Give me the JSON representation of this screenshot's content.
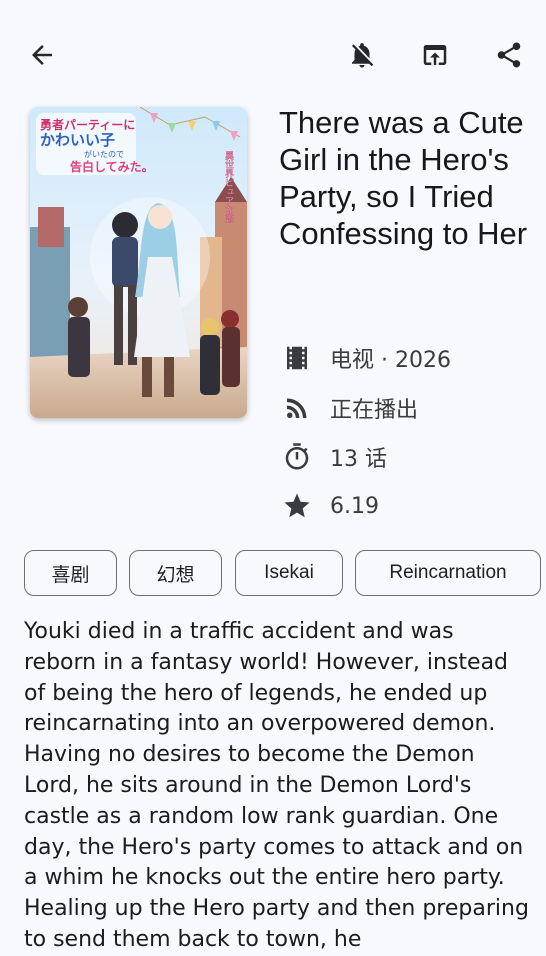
{
  "header": {
    "back_icon": "arrow-back-icon",
    "notifications_icon": "notifications-off-icon",
    "open_icon": "open-in-browser-icon",
    "share_icon": "share-icon"
  },
  "anime": {
    "title": "There was a Cute Girl in the Hero's Party, so I Tried Confessing to Her",
    "poster_title_lines": [
      "勇者パーティーに",
      "かわいい子",
      "がいたので",
      "告白してみた。"
    ],
    "poster_side_text": "異世界ピュアな恋",
    "type_year": "电视 · 2026",
    "status": "正在播出",
    "episodes": "13 话",
    "score": "6.19"
  },
  "tags": [
    "喜剧",
    "幻想",
    "Isekai",
    "Reincarnation"
  ],
  "description": "Youki died in a traffic accident and was reborn in a fantasy world! However, instead of being the hero of legends, he ended up reincarnating into an overpowered demon. Having no desires to become the Demon Lord, he sits around in the Demon Lord's castle as a random low rank guardian. One day, the Hero's party comes to attack and on a whim he knocks out the entire hero party. Healing up the Hero party and then preparing to send them back to town, he",
  "colors": {
    "background": "#f8f9fe",
    "icon": "#26272b",
    "chip_border": "#6e7076"
  }
}
